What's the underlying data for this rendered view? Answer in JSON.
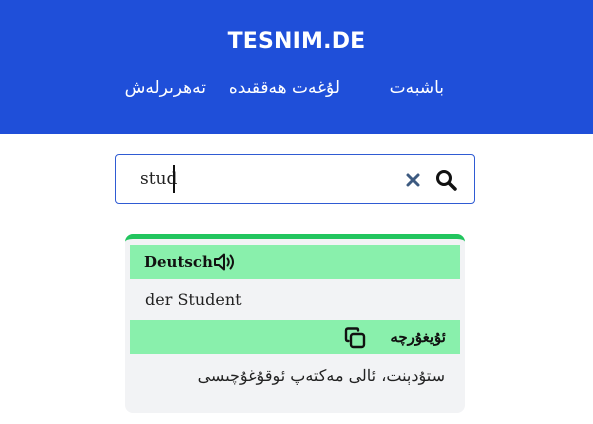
{
  "header": {
    "brand": "TESNIM.DE",
    "nav": [
      {
        "label": "باشبەت"
      },
      {
        "label": "لۇغەت ھەققىدە"
      },
      {
        "label": "تەھرىرلەش"
      }
    ],
    "color": "#1f4fd9"
  },
  "search": {
    "value": "stud",
    "clear_icon": "close-icon",
    "search_icon": "search-icon"
  },
  "result": {
    "source_language": "Deutsch",
    "source_term": "der  Student",
    "target_language": "ئۇيغۇرچە",
    "target_term": "ستۇدېنت، ئالى مەكتەپ ئوقۇغۇچىسى",
    "accent_color": "#22c55e",
    "language_bar_color": "#89f0ac",
    "speaker_icon": "speaker-icon",
    "copy_icon": "copy-icon"
  }
}
